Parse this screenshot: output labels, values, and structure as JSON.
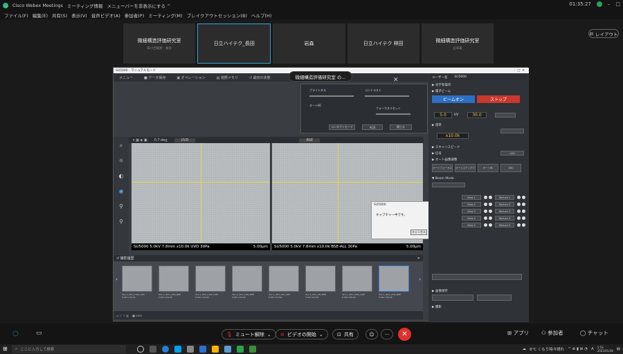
{
  "titlebar": {
    "app_name": "Cisco Webex Meetings",
    "meeting_info": "ミーティング情報",
    "menu_toggle": "メニューバーを非表示にする ^",
    "time": "01:35:27",
    "minimize": "–",
    "close": "□"
  },
  "menubar": [
    "ファイル(F)",
    "編集(E)",
    "共有(S)",
    "表示(V)",
    "音声ビデオ(A)",
    "参加者(P)",
    "ミーティング(M)",
    "ブレイクアウトセッション(B)",
    "ヘルプ(H)"
  ],
  "participants": [
    {
      "name": "微細構造評価研究室",
      "sub": "布川吉総屋 · 長谷"
    },
    {
      "name": "日立ハイテク_長田",
      "sub": ""
    },
    {
      "name": "岩森",
      "sub": ""
    },
    {
      "name": "日立ハイテク 林田",
      "sub": ""
    },
    {
      "name": "微細構造評価研究室",
      "sub": "五味兼"
    }
  ],
  "layout_button": "レイアウト",
  "app": {
    "title": "SU5000 - マニュアルモード",
    "sharer": "微細構造評価研究室 の...",
    "toolbar": [
      "メニュー",
      "■ データ保存",
      "▣ オペレーション",
      "▤ 視野メモリ",
      "↺ 最初の状態"
    ],
    "popup": {
      "labels": [
        "ブライトネス",
        "コントラスト",
        "オートBC",
        "フォーカスリセット"
      ],
      "buttons": [
        "コンタクトモード",
        "ACB",
        "閉じる"
      ]
    },
    "image_header": {
      "items": [
        "0.7 deg",
        "UVD",
        "BSE"
      ]
    },
    "captions": [
      {
        "text": "SU5000 5.0kV 7.8mm x10.0k UVD 30Pa",
        "scale": "5.00μm"
      },
      {
        "text": "SU5000 5.0kV 7.8mm x10.0k BSE-ALL 30Pa",
        "scale": "5.00μm"
      }
    ],
    "dialog": {
      "title": "SU5000",
      "message": "キャプチャー中です。",
      "cancel": "キャンセル"
    },
    "thumb_header": "↺ 撮影履歴",
    "thumbs": [
      {
        "label": "311-1_5kV_x10k_UVD",
        "sub": "5.0kV x10.0k"
      },
      {
        "label": "311-1_5kV_x10k_BSE",
        "sub": "5.0kV x10.0k"
      },
      {
        "label": "311-1_5kV_x10k_UVD",
        "sub": "5.0kV x10.0k"
      },
      {
        "label": "311-1_5kV_x10k_BSE",
        "sub": "5.0kV x10.0k"
      },
      {
        "label": "311-1_5kV_x5k_UVD",
        "sub": "5.0kV x5.00k"
      },
      {
        "label": "311-1_5kV_x5k_BSE",
        "sub": "5.0kV x5.00k"
      },
      {
        "label": "311-1_5kV_x20k_UVD",
        "sub": "5.0kV x20.0k"
      },
      {
        "label": "311-1_5kV_x20k_BSE",
        "sub": "5.0kV x20.0k"
      }
    ],
    "thumb_footer": "■ auto",
    "rpanel": {
      "mode": "ユーザー名",
      "model": "SU5000",
      "sections": [
        "▶ 光学系操作",
        "▶ 電子ビーム",
        "▶ 倍率",
        "▶ スキャンスピード",
        "▶ 信号",
        "▶ オート画像調整",
        "▼ Beam Mode",
        "▶ 画像保存",
        "▶ 撮影"
      ],
      "beam_on": "ビームオン",
      "stop": "ストップ",
      "accel_value": "5.0",
      "accel_unit": "kV",
      "spot_value": "30.0",
      "magnification": "x10.0k",
      "signal": "UVD",
      "auto_buttons": [
        "オートフォーカス",
        "オートスティグマ",
        "オートBC",
        "ABC"
      ],
      "beam_modes": [
        "Slow 1",
        "Slow 2",
        "Slow 3",
        "Slow 4",
        "Slow 5"
      ],
      "reduce": [
        "Reduce 1",
        "Reduce 2",
        "Reduce 3",
        "Reduce 4",
        "Reduce 5"
      ]
    }
  },
  "bottombar": {
    "unmute": "ミュート解除",
    "video": "ビデオの開始",
    "share": "共有",
    "apps": "アプリ",
    "participants": "参加者",
    "chat": "チャット"
  },
  "taskbar": {
    "search_placeholder": "ここに入力して検索",
    "weather": "8°C くもり時々晴れ",
    "ime": "A",
    "time": "1:53",
    "date": "2021/01/28"
  }
}
